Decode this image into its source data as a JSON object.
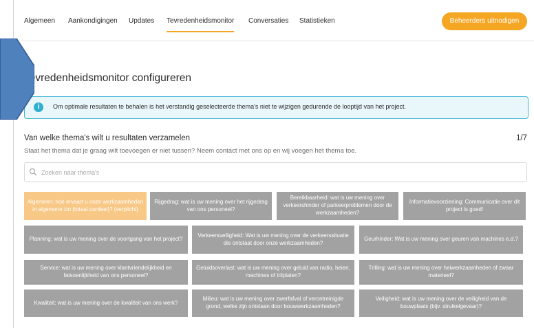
{
  "tabs": [
    {
      "label": "Algemeen"
    },
    {
      "label": "Aankondigingen"
    },
    {
      "label": "Updates"
    },
    {
      "label": "Tevredenheidsmonitor"
    },
    {
      "label": "Conversaties"
    },
    {
      "label": "Statistieken"
    }
  ],
  "active_tab": "Tevredenheidsmonitor",
  "invite_button": "Beheerders uitnodigen",
  "page_title": "Tevredenheidsmonitor configureren",
  "info_message": "Om optimale resultaten te behalen is het verstandig geselecteerde thema's niet te wijzigen gedurende de looptijd van het project.",
  "section": {
    "heading": "Van welke thema's wilt u resultaten verzamelen",
    "counter": "1/7",
    "subtitle": "Staat het thema dat je graag wilt toevoegen er niet tussen? Neem contact met ons op en wij voegen het thema toe."
  },
  "search": {
    "placeholder": "Zoeken naar thema's",
    "value": ""
  },
  "themes": [
    {
      "label": "Algemeen: hoe ervaart u onze werkzaamheden in algemene zin (totaal oordeel)? (verplicht)",
      "selected": true
    },
    {
      "label": "Rijgedrag: wat is uw mening over het rijgedrag van ons personeel?",
      "selected": false
    },
    {
      "label": "Bereikbaarheid: wat is uw mening over verkeershinder of parkeerproblemen door de werkzaamheden?",
      "selected": false
    },
    {
      "label": "Informatievoorziening: Communicatie over dit project is goed!",
      "selected": false
    },
    {
      "label": "Planning: wat is uw mening over de voortgang van het project?",
      "selected": false
    },
    {
      "label": "Verkeersveiligheid: Wat is uw mening over de verkeerssituatie die ontstaat door onze werkzaamheden?",
      "selected": false
    },
    {
      "label": "Geurhinder: Wat is uw mening over geuren van machines e.d.?",
      "selected": false
    },
    {
      "label": "Service: wat is uw mening over klantvriendelijkheid en fatsoenlijkheid van ons personeel?",
      "selected": false
    },
    {
      "label": "Geluidsoverlast: wat is uw mening over geluid van radio, heien, machines of trilplaten?",
      "selected": false
    },
    {
      "label": "Trilling: wat is uw mening over heiwerkzaamheden of zwaar materieel?",
      "selected": false
    },
    {
      "label": "Kwaliteit: wat is uw mening over de kwaliteit van ons werk?",
      "selected": false
    },
    {
      "label": "Milieu: wat is uw mening over zwerfafval of verontreinigde grond, welke zijn ontstaan door bouwwerkzaamheden?",
      "selected": false
    },
    {
      "label": "Veiligheid: wat is uw mening over de veiligheid van de bouwplaats (bijv. struikelgevaar)?",
      "selected": false
    }
  ],
  "colors": {
    "accent": "#f5a623",
    "chip_default": "#a2a2a2",
    "chip_selected": "#f8c887",
    "info_border": "#41b6d6",
    "info_bg": "#e9f6fa",
    "arrow_fill": "#4f81bd"
  },
  "icons": {
    "info": "info-icon",
    "search": "search-icon"
  }
}
